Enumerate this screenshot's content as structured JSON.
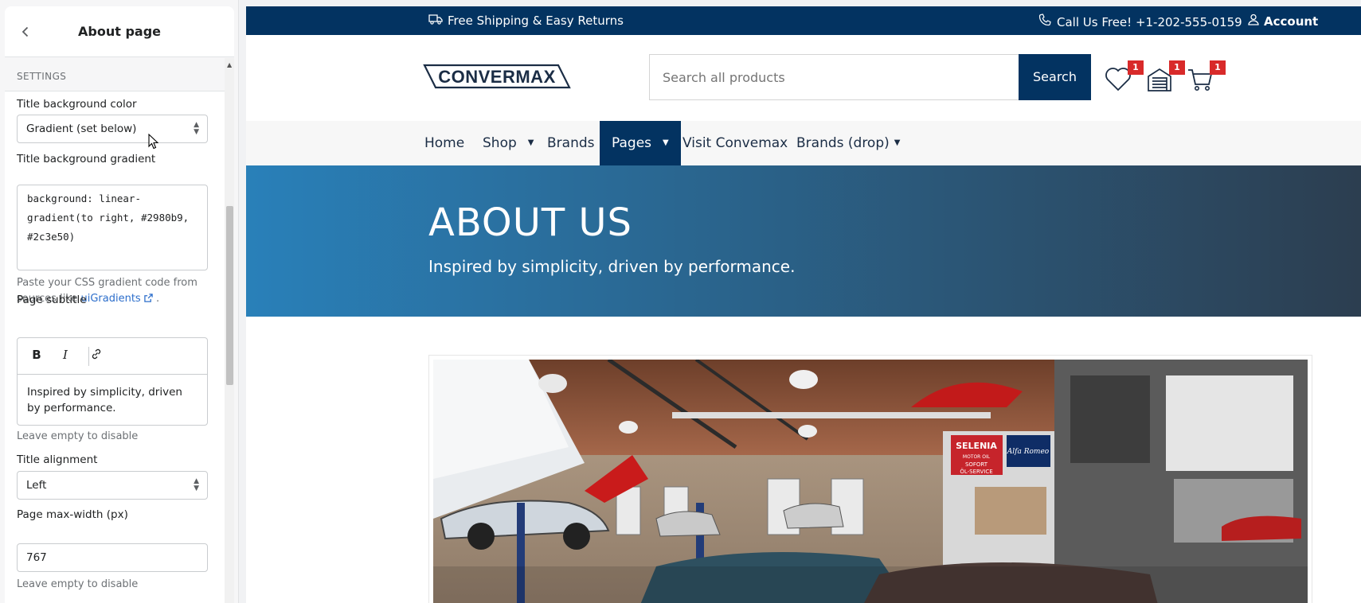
{
  "editor": {
    "header": {
      "title": "About page",
      "back_icon": "chevron-left-icon"
    },
    "section_label": "SETTINGS",
    "fields": {
      "title_bg_color": {
        "label": "Title background color",
        "value": "Gradient (set below)"
      },
      "title_bg_gradient": {
        "label": "Title background gradient",
        "value": "background: linear-\ngradient(to right, #2980b9,\n#2c3e50)",
        "help_prefix": "Paste your CSS gradient code from sources like ",
        "help_link": "uiGradients",
        "help_suffix": " ."
      },
      "page_subtitle": {
        "label": "Page subtitle",
        "bold": "B",
        "italic": "I",
        "value": "Inspired by simplicity, driven by performance.",
        "help": "Leave empty to disable"
      },
      "title_alignment": {
        "label": "Title alignment",
        "value": "Left"
      },
      "page_max_width": {
        "label": "Page max-width (px)",
        "value": "767",
        "help": "Leave empty to disable"
      }
    }
  },
  "store": {
    "topbar": {
      "shipping": "Free Shipping & Easy Returns",
      "phone": "Call Us Free! +1-202-555-0159",
      "account": "Account"
    },
    "logo": "CONVERMAX",
    "search": {
      "placeholder": "Search all products",
      "button": "Search"
    },
    "header_icons": [
      {
        "name": "wishlist-icon",
        "count": "1"
      },
      {
        "name": "garage-icon",
        "count": "1"
      },
      {
        "name": "cart-icon",
        "count": "1"
      }
    ],
    "nav": [
      "Home",
      "Shop",
      "Brands",
      "Pages",
      "Visit Convemax",
      "Brands (drop)"
    ],
    "hero": {
      "title": "ABOUT US",
      "subtitle": "Inspired by simplicity, driven by performance."
    },
    "photo_signs": {
      "sign1_line1": "SELENIA",
      "sign1_line2": "MOTOR OIL",
      "sign1_line3": "SOFORT",
      "sign1_line4": "ÖL-SERVICE",
      "sign2": "Alfa Romeo"
    }
  },
  "colors": {
    "navy": "#033361",
    "gradient_start": "#2980b9",
    "gradient_end": "#2c3e50",
    "badge": "#d82a2a"
  }
}
